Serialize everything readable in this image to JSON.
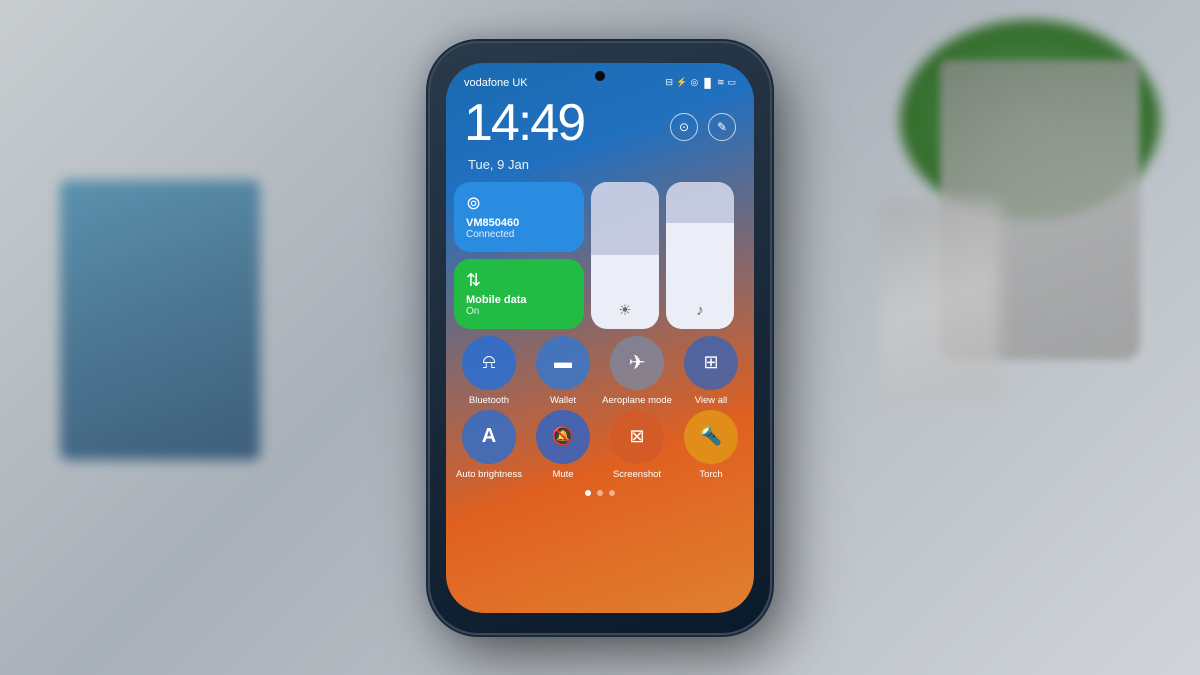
{
  "scene": {
    "background_desc": "Blurred background with blue box and plant/pot"
  },
  "phone": {
    "status_bar": {
      "carrier": "vodafone UK",
      "icons": [
        "sim-icon",
        "bluetooth-icon",
        "nfc-icon",
        "signal-icon",
        "wifi-icon",
        "battery-icon"
      ]
    },
    "clock": {
      "time": "14:49",
      "date": "Tue, 9 Jan"
    },
    "quick_settings": {
      "wifi_tile": {
        "name": "VM850460",
        "status": "Connected"
      },
      "mobile_tile": {
        "name": "Mobile data",
        "status": "On"
      },
      "brightness_slider_label": "☀",
      "volume_slider_label": "♪"
    },
    "circle_row1": [
      {
        "id": "bluetooth",
        "label": "Bluetooth",
        "icon": "⦾",
        "color": "c-blue"
      },
      {
        "id": "wallet",
        "label": "Wallet",
        "icon": "▬",
        "color": "c-blue2"
      },
      {
        "id": "aeroplane",
        "label": "Aeroplane mode",
        "icon": "✈",
        "color": "c-gray"
      },
      {
        "id": "viewall",
        "label": "View all",
        "icon": "▤",
        "color": "c-blue3"
      }
    ],
    "circle_row2": [
      {
        "id": "autobrightness",
        "label": "Auto brightness",
        "icon": "A",
        "color": "c-blue4"
      },
      {
        "id": "mute",
        "label": "Mute",
        "icon": "🔕",
        "color": "c-blue5"
      },
      {
        "id": "screenshot",
        "label": "Screenshot",
        "icon": "⊠",
        "color": "c-orange"
      },
      {
        "id": "torch",
        "label": "Torch",
        "icon": "🔦",
        "color": "c-amber"
      }
    ],
    "pagination": {
      "dots": [
        true,
        false,
        false
      ],
      "active_index": 0
    }
  }
}
